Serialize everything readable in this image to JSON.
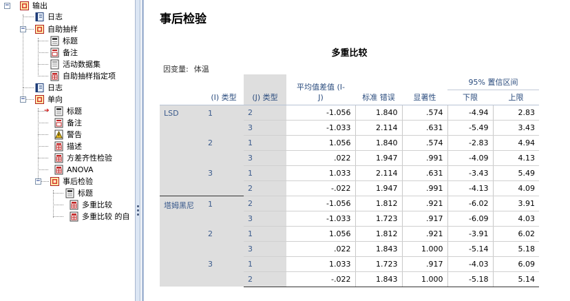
{
  "tree": {
    "items": [
      {
        "label": "输出",
        "icon": "output-book-icon",
        "level": 0,
        "toggle": "−"
      },
      {
        "label": "日志",
        "icon": "log-book-icon",
        "level": 1
      },
      {
        "label": "自助抽样",
        "icon": "output-book-icon",
        "level": 1,
        "toggle": "−"
      },
      {
        "label": "标题",
        "icon": "title-page-icon",
        "level": 2
      },
      {
        "label": "备注",
        "icon": "notes-page-icon",
        "level": 2
      },
      {
        "label": "活动数据集",
        "icon": "page-icon",
        "level": 2
      },
      {
        "label": "自助抽样指定项",
        "icon": "table-page-icon",
        "level": 2
      },
      {
        "label": "日志",
        "icon": "log-book-icon",
        "level": 1
      },
      {
        "label": "单向",
        "icon": "output-book-icon",
        "level": 1,
        "toggle": "−"
      },
      {
        "label": "标题",
        "icon": "title-page-icon",
        "level": 2,
        "selected": true
      },
      {
        "label": "备注",
        "icon": "notes-page-icon",
        "level": 2
      },
      {
        "label": "警告",
        "icon": "warning-page-icon",
        "level": 2
      },
      {
        "label": "描述",
        "icon": "table-page-icon",
        "level": 2
      },
      {
        "label": "方差齐性检验",
        "icon": "table-page-icon",
        "level": 2
      },
      {
        "label": "ANOVA",
        "icon": "table-page-icon",
        "level": 2
      },
      {
        "label": "事后检验",
        "icon": "output-book-icon",
        "level": 2,
        "toggle": "−"
      },
      {
        "label": "标题",
        "icon": "title-page-icon",
        "level": 3
      },
      {
        "label": "多重比较",
        "icon": "table-page-icon",
        "level": 3
      },
      {
        "label": "多重比较 的自",
        "icon": "table-page-icon",
        "level": 3
      }
    ]
  },
  "content": {
    "page_title": "事后检验",
    "table_title": "多重比较",
    "dependent_variable_label": "因变量:",
    "dependent_variable": "体温",
    "headers": {
      "i_type": "(I) 类型",
      "j_type": "(J) 类型",
      "mean_diff_line1": "平均值差值 (I-",
      "mean_diff_line2": "J)",
      "std_error": "标准 错误",
      "significance": "显著性",
      "ci": "95% 置信区间",
      "lower": "下限",
      "upper": "上限"
    },
    "groups": [
      {
        "method": "LSD",
        "blocks": [
          {
            "i": "1",
            "rows": [
              {
                "j": "2",
                "md": "-1.056",
                "se": "1.840",
                "sig": ".574",
                "lo": "-4.94",
                "hi": "2.83"
              },
              {
                "j": "3",
                "md": "-1.033",
                "se": "2.114",
                "sig": ".631",
                "lo": "-5.49",
                "hi": "3.43"
              }
            ]
          },
          {
            "i": "2",
            "rows": [
              {
                "j": "1",
                "md": "1.056",
                "se": "1.840",
                "sig": ".574",
                "lo": "-2.83",
                "hi": "4.94"
              },
              {
                "j": "3",
                "md": ".022",
                "se": "1.947",
                "sig": ".991",
                "lo": "-4.09",
                "hi": "4.13"
              }
            ]
          },
          {
            "i": "3",
            "rows": [
              {
                "j": "1",
                "md": "1.033",
                "se": "2.114",
                "sig": ".631",
                "lo": "-3.43",
                "hi": "5.49"
              },
              {
                "j": "2",
                "md": "-.022",
                "se": "1.947",
                "sig": ".991",
                "lo": "-4.13",
                "hi": "4.09"
              }
            ]
          }
        ]
      },
      {
        "method": "塔姆黑尼",
        "blocks": [
          {
            "i": "1",
            "rows": [
              {
                "j": "2",
                "md": "-1.056",
                "se": "1.812",
                "sig": ".921",
                "lo": "-6.02",
                "hi": "3.91"
              },
              {
                "j": "3",
                "md": "-1.033",
                "se": "1.723",
                "sig": ".917",
                "lo": "-6.09",
                "hi": "4.03"
              }
            ]
          },
          {
            "i": "2",
            "rows": [
              {
                "j": "1",
                "md": "1.056",
                "se": "1.812",
                "sig": ".921",
                "lo": "-3.91",
                "hi": "6.02"
              },
              {
                "j": "3",
                "md": ".022",
                "se": "1.843",
                "sig": "1.000",
                "lo": "-5.14",
                "hi": "5.18"
              }
            ]
          },
          {
            "i": "3",
            "rows": [
              {
                "j": "1",
                "md": "1.033",
                "se": "1.723",
                "sig": ".917",
                "lo": "-4.03",
                "hi": "6.09"
              },
              {
                "j": "2",
                "md": "-.022",
                "se": "1.843",
                "sig": "1.000",
                "lo": "-5.18",
                "hi": "5.14"
              }
            ]
          }
        ]
      }
    ]
  }
}
